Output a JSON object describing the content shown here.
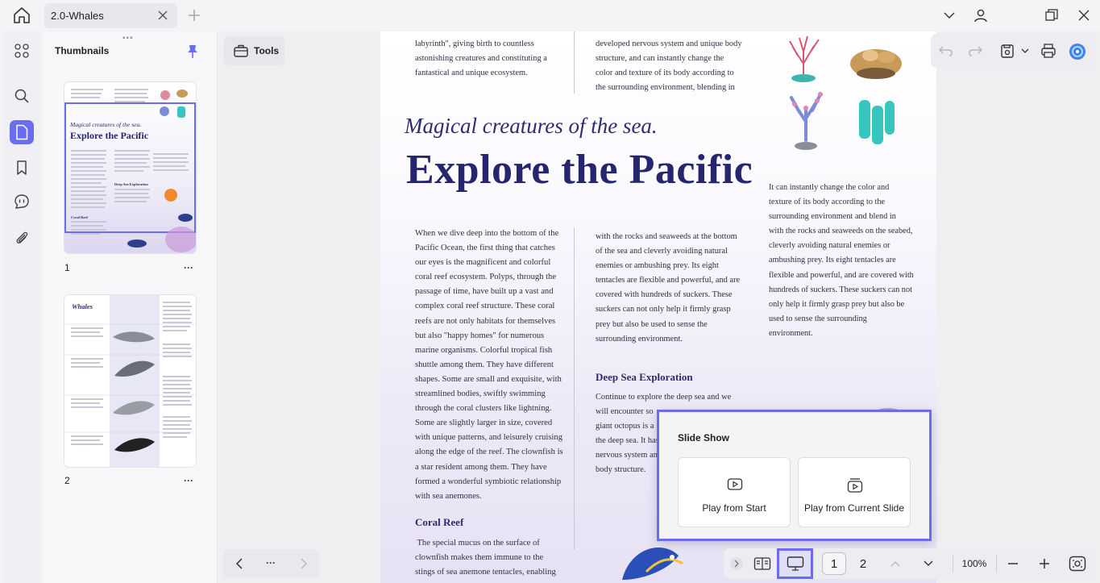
{
  "tab": {
    "title": "2.0-Whales"
  },
  "panel": {
    "title": "Thumbnails",
    "pages": [
      {
        "number": "1",
        "more": "···"
      },
      {
        "number": "2",
        "more": "···"
      }
    ]
  },
  "thumb1": {
    "magical": "Magical creatures of the sea.",
    "explore": "Explore the Pacific",
    "coral": "Coral Reef",
    "deep": "Deep Sea Exploration"
  },
  "thumb2": {
    "title": "Whales"
  },
  "tools": {
    "label": "Tools"
  },
  "document": {
    "col2_top": "labyrinth\", giving birth to countless\nastonishing creatures and constituting a\nfantastical and unique ecosystem.",
    "col3_top": "developed nervous system and unique body\nstructure, and can instantly change the\ncolor and texture of its body according to\nthe surrounding environment, blending in",
    "magical": "Magical creatures of the sea.",
    "explore": "Explore the Pacific",
    "right_para": "It can instantly change the color and\ntexture of its body according to the\nsurrounding environment and blend in\nwith the rocks and seaweeds on the seabed,\ncleverly avoiding natural enemies or\nambushing prey. Its eight tentacles are\nflexible and powerful, and are covered with\nhundreds of suckers. These suckers can not\nonly help it firmly grasp prey but also be\nused to sense the surrounding\nenvironment.",
    "col1_body": "When we dive deep into the bottom of the\nPacific Ocean, the first thing that catches\nour eyes is the magnificent and colorful\ncoral reef ecosystem. Polyps, through the\npassage of time, have built up a vast and\ncomplex coral reef structure. These coral\nreefs are not only habitats for themselves\nbut also \"happy homes\" for numerous\nmarine organisms. Colorful tropical fish\nshuttle among them. They have different\nshapes. Some are small and exquisite, with\nstreamlined bodies, swiftly swimming\nthrough the coral clusters like lightning.\nSome are slightly larger in size, covered\nwith unique patterns, and leisurely cruising\nalong the edge of the reef. The clownfish is\na star resident among them. They have\nformed a wonderful symbiotic relationship\nwith sea anemones.",
    "col2_body": "with the rocks and seaweeds at the bottom\nof the sea and cleverly avoiding natural\nenemies or ambushing prey. Its eight\ntentacles are flexible and powerful, and are\ncovered with hundreds of suckers. These\nsuckers can not only help it firmly grasp\nprey but also be used to sense the\nsurrounding environment.",
    "deep_heading": "Deep Sea Exploration",
    "deep_body": "Continue to explore the deep sea and we\nwill encounter so\ngiant octopus is a\nthe deep sea. It has\nnervous system and\nbody structure.",
    "coral_heading": "Coral Reef",
    "coral_body": " The special mucus on the surface of\nclownfish makes them immune to the\nstings of sea anemone tentacles, enabling"
  },
  "slideshow": {
    "title": "Slide Show",
    "play_start": "Play from Start",
    "play_current": "Play from Current Slide"
  },
  "bottom": {
    "page1": "1",
    "page2": "2",
    "zoom": "100%",
    "dots": "···"
  },
  "colors": {
    "accent": "#6b6df0",
    "heading": "#26266e"
  },
  "icons": [
    "home-icon",
    "close-icon",
    "plus-icon",
    "chevron-down-icon",
    "user-icon",
    "restore-icon",
    "thumbnails-grid-icon",
    "search-icon",
    "page-icon",
    "bookmark-icon",
    "comment-icon",
    "attachment-icon",
    "pin-icon",
    "toolbox-icon",
    "undo-icon",
    "redo-icon",
    "save-icon",
    "print-icon",
    "ai-assistant-icon",
    "play-icon",
    "slideshow-icon",
    "zoom-out-icon",
    "zoom-in-icon",
    "fit-icon"
  ]
}
